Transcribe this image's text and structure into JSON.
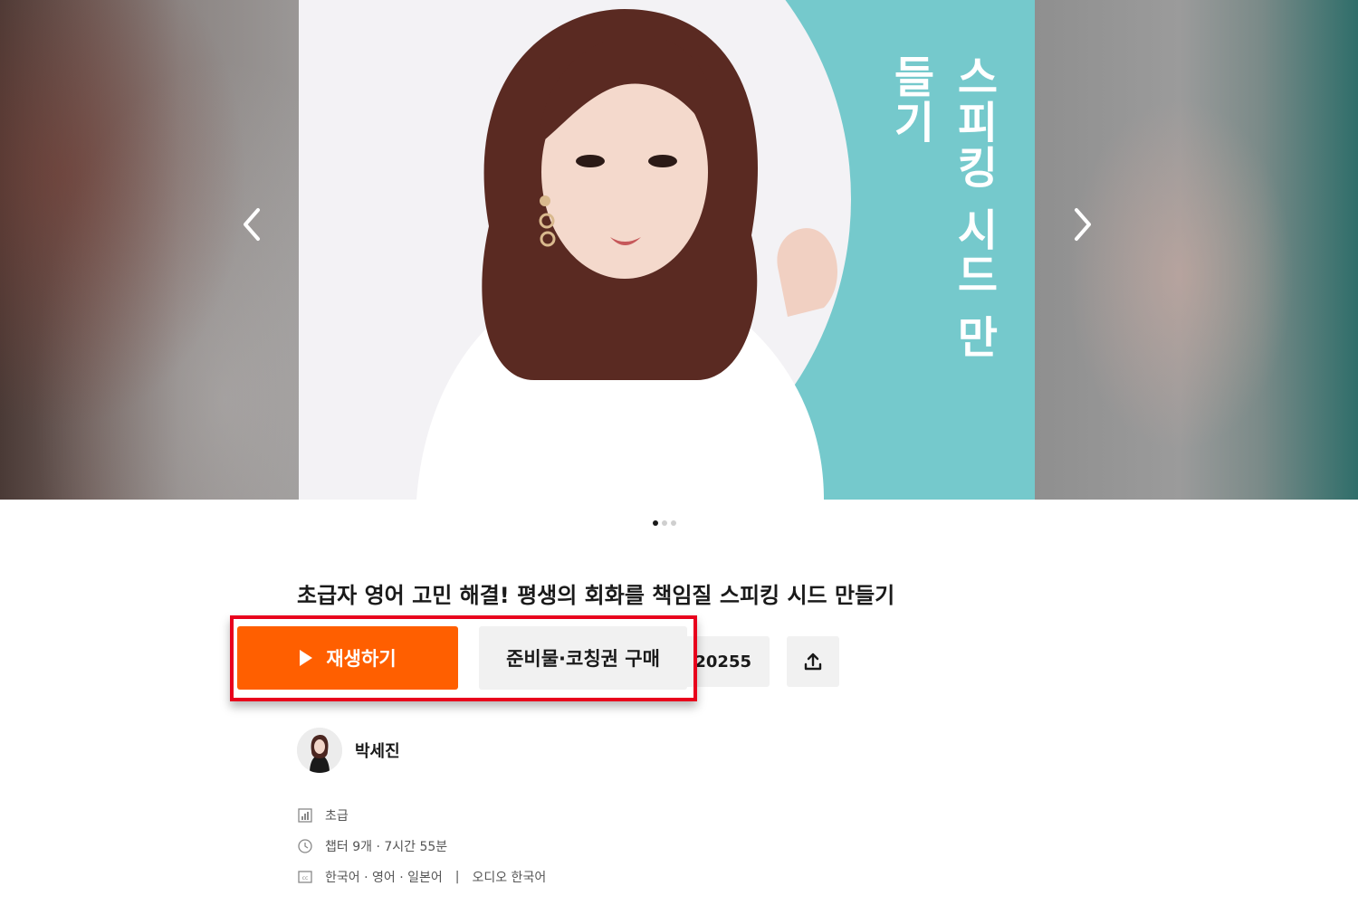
{
  "carousel": {
    "slide_text": "스피킹 시드 만들기",
    "slide_count": 3,
    "active_index": 0,
    "colors": {
      "slide_bg": "#75c9cc",
      "slide_white": "#f3f2f5"
    }
  },
  "course": {
    "title": "초급자 영어 고민 해결! 평생의 회화를 책임질 스피킹 시드 만들기"
  },
  "actions": {
    "play_label": "재생하기",
    "buy_label": "준비물·코칭권 구매",
    "like_count": "20255",
    "colors": {
      "play_bg": "#ff5f00",
      "secondary_bg": "#f1f1f1",
      "highlight": "#e8001c"
    }
  },
  "creator": {
    "name": "박세진"
  },
  "meta": {
    "level": "초급",
    "duration": "챕터 9개 · 7시간 55분",
    "subtitles": "한국어 · 영어 · 일본어",
    "separator": "|",
    "audio": "오디오 한국어"
  }
}
